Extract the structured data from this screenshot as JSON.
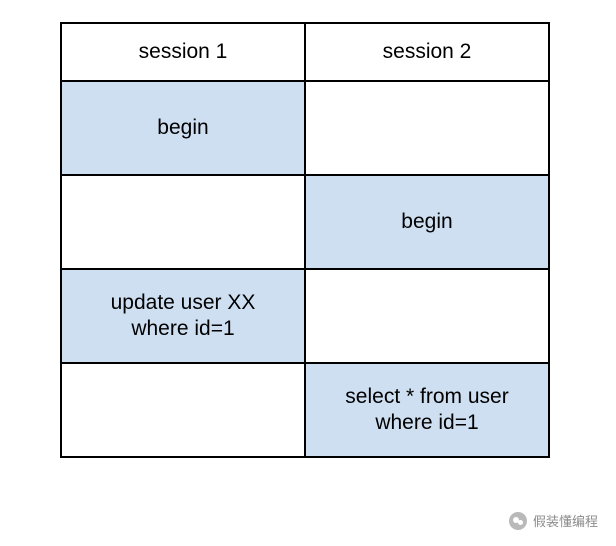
{
  "table": {
    "headers": [
      "session 1",
      "session 2"
    ],
    "rows": [
      {
        "col1": "begin",
        "col2": "",
        "hl1": true,
        "hl2": false
      },
      {
        "col1": "",
        "col2": "begin",
        "hl1": false,
        "hl2": true
      },
      {
        "col1": "update user XX\nwhere id=1",
        "col2": "",
        "hl1": true,
        "hl2": false
      },
      {
        "col1": "",
        "col2": "select * from user\nwhere id=1",
        "hl1": false,
        "hl2": true
      }
    ]
  },
  "watermark": {
    "text": "假装懂编程"
  }
}
